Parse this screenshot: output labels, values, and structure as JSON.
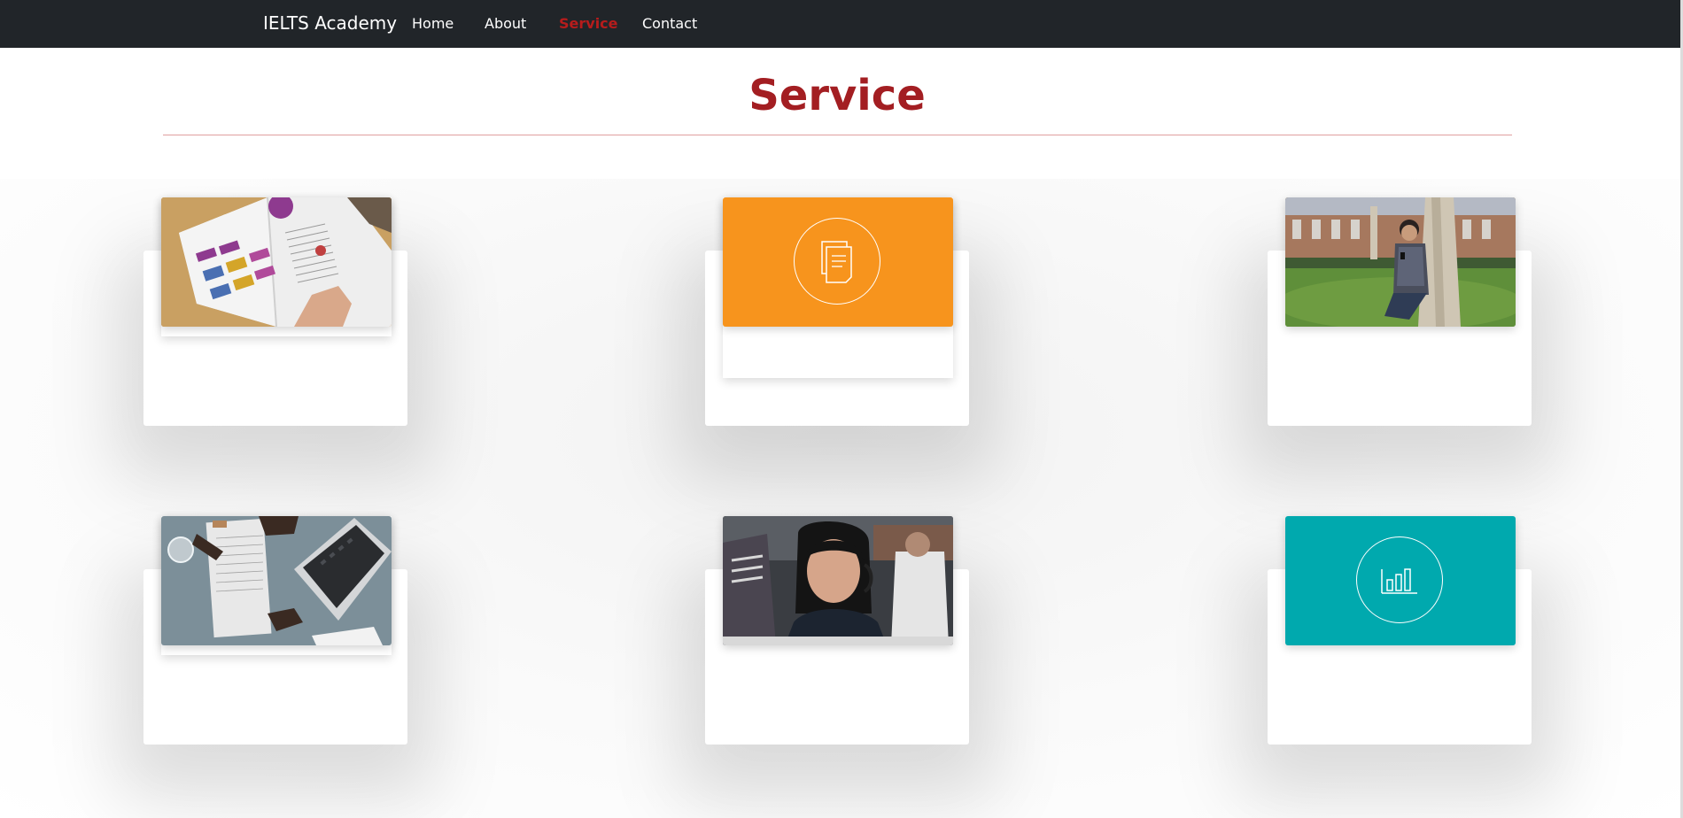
{
  "navbar": {
    "brand": "IELTS Academy",
    "links": [
      {
        "label": "Home",
        "active": false
      },
      {
        "label": "About",
        "active": false
      },
      {
        "label": "Service",
        "active": true
      },
      {
        "label": "Contact",
        "active": false
      }
    ],
    "background": "#212529",
    "link_color": "#ffffff",
    "active_color": "#b71c1c"
  },
  "header": {
    "title": "Service",
    "title_color": "#a31e22",
    "rule_color": "#e0a0a0"
  },
  "services": [
    {
      "media": "photo-magazine",
      "icon": null,
      "accent": null
    },
    {
      "media": "icon-tile",
      "icon": "documents-icon",
      "accent": "#f7941d"
    },
    {
      "media": "photo-student-tree",
      "icon": null,
      "accent": null
    },
    {
      "media": "photo-desk-laptop",
      "icon": null,
      "accent": null
    },
    {
      "media": "photo-call-center",
      "icon": null,
      "accent": null
    },
    {
      "media": "icon-tile",
      "icon": "bar-chart-icon",
      "accent": "#00a9ae"
    }
  ]
}
